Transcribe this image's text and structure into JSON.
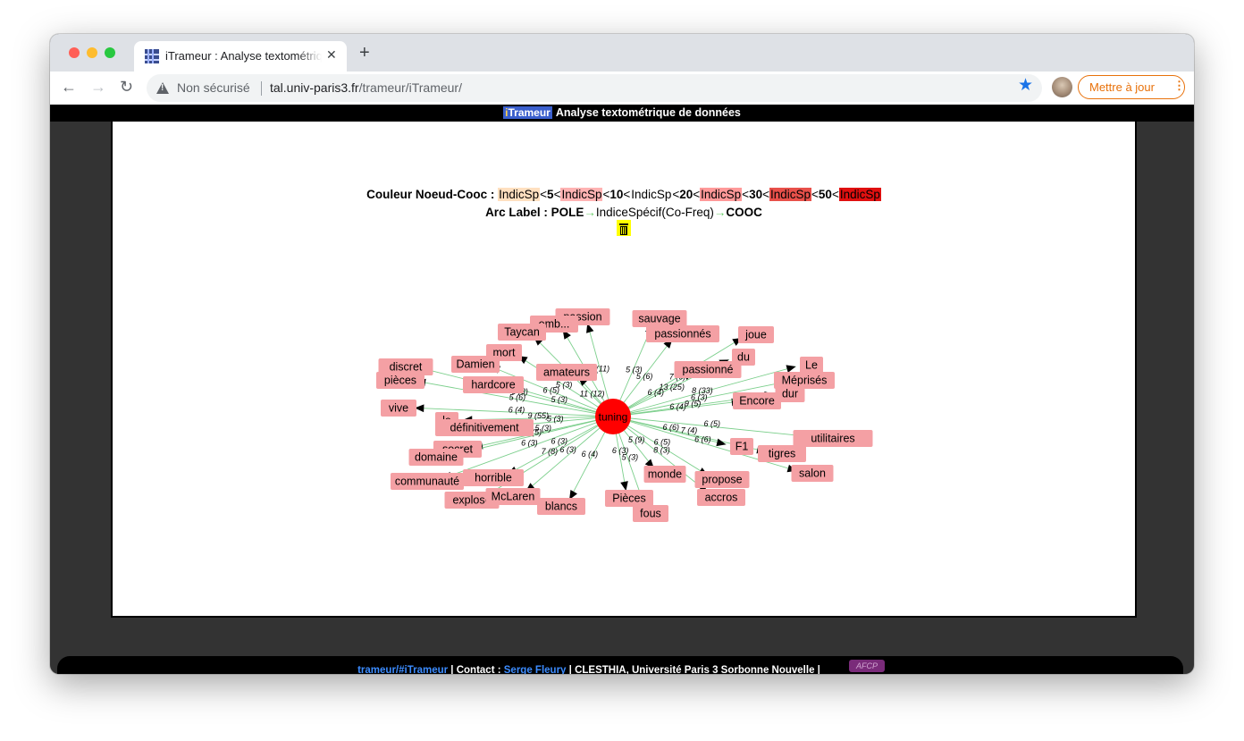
{
  "browser": {
    "tab_title": "iTrameur : Analyse textométrique de données",
    "new_tab": "+",
    "tab_close": "✕",
    "security_label": "Non sécurisé",
    "url_host": "tal.univ-paris3.fr",
    "url_path": "/trameur/iTrameur/",
    "update_button": "Mettre à jour",
    "traffic_light_colors": [
      "#ff5f57",
      "#febc2e",
      "#28c840"
    ]
  },
  "app": {
    "brand": "iTrameur",
    "title": "Analyse textométrique de données"
  },
  "legend": {
    "node_prefix": "Couleur Noeud-Cooc :",
    "indic": "IndicSp",
    "lt": "<",
    "thresholds": [
      "5",
      "10",
      "20",
      "30",
      "50"
    ],
    "band_colors": [
      "#ffe0c0",
      "#ffb3b3",
      "#ffffff",
      "#ff9999",
      "#e8504a",
      "#e01010"
    ],
    "arc_prefix": "Arc Label :",
    "pole": "POLE",
    "indice": "IndiceSpécif(Co-Freq)",
    "cooc": "COOC",
    "arrow": "→"
  },
  "graph": {
    "center": "tuning",
    "nodes": [
      {
        "label": "passion",
        "edge": "6 (11)"
      },
      {
        "label": "emb...",
        "edge": "6 (3)"
      },
      {
        "label": "Taycan",
        "edge": "5 (3)"
      },
      {
        "label": "mort",
        "edge": "5 (3)"
      },
      {
        "label": "Damien",
        "edge": "6 (5)"
      },
      {
        "label": "discret",
        "edge": "5 (3)"
      },
      {
        "label": "pièces",
        "edge": "5 (6)"
      },
      {
        "label": "amateurs",
        "edge": "11 (12)"
      },
      {
        "label": "hardcore",
        "edge": "5 (3)"
      },
      {
        "label": "vive",
        "edge": "6 (4)"
      },
      {
        "label": "le",
        "edge": "9 (55)"
      },
      {
        "label": "définitivement",
        "edge": "5 (3)"
      },
      {
        "label": "secret",
        "edge": "5 (3)"
      },
      {
        "label": "domaine",
        "edge": "7 (5)"
      },
      {
        "label": "communauté",
        "edge": "6 (3)"
      },
      {
        "label": "horrible",
        "edge": "6 (3)"
      },
      {
        "label": "explose",
        "edge": "7 (8)"
      },
      {
        "label": "McLaren",
        "edge": "6 (3)"
      },
      {
        "label": "blancs",
        "edge": "6 (4)"
      },
      {
        "label": "Pièces",
        "edge": "6 (3)"
      },
      {
        "label": "fous",
        "edge": "5 (3)"
      },
      {
        "label": "monde",
        "edge": "5 (9)"
      },
      {
        "label": "propose",
        "edge": "6 (5)"
      },
      {
        "label": "accros",
        "edge": "8 (3)"
      },
      {
        "label": "salon",
        "edge": "6 (6)"
      },
      {
        "label": "tigres",
        "edge": "7 (4)"
      },
      {
        "label": "F1",
        "edge": "6 (6)"
      },
      {
        "label": "utilitaires",
        "edge": "6 (5)"
      },
      {
        "label": "Encore",
        "edge": "6 (4)"
      },
      {
        "label": "dur",
        "edge": "9 (5)"
      },
      {
        "label": "Méprisés",
        "edge": "6 (3)"
      },
      {
        "label": "Le",
        "edge": "8 (33)"
      },
      {
        "label": "du",
        "edge": "13 (25)"
      },
      {
        "label": "joue",
        "edge": "7 (6)"
      },
      {
        "label": "passionné",
        "edge": "6 (4)"
      },
      {
        "label": "passionnés",
        "edge": "5 (6)"
      },
      {
        "label": "sauvage",
        "edge": "5 (3)"
      }
    ]
  },
  "footer": {
    "link1": "trameur/#iTrameur",
    "contact_label": "Contact :",
    "contact_name": "Serge Fleury",
    "affiliation": "CLESTHIA, Université Paris 3 Sorbonne Nouvelle",
    "bar": "|",
    "logo": "AFCP"
  }
}
